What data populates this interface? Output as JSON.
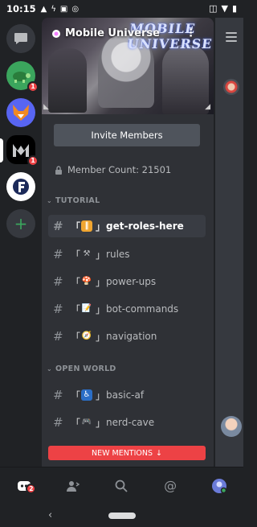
{
  "status_bar": {
    "time": "10:15",
    "icons": [
      "signal-icon",
      "bolt-icon",
      "gallery-icon",
      "sync-icon"
    ],
    "right_icons": [
      "vibrate-icon",
      "wifi-icon",
      "battery-icon"
    ]
  },
  "rail": {
    "servers": [
      {
        "name": "direct-messages",
        "icon": "chat-icon",
        "color": "#36393f"
      },
      {
        "name": "turtle-server",
        "icon": "turtle-icon",
        "color": "#3ba55d",
        "badge": "1"
      },
      {
        "name": "fox-server",
        "icon": "fox-icon",
        "color": "#5865f2"
      },
      {
        "name": "mobile-universe",
        "icon": "mu-logo-icon",
        "color": "#000000",
        "badge": "1",
        "selected": true
      },
      {
        "name": "f-server",
        "icon": "f-logo-icon",
        "color": "#ffffff"
      }
    ],
    "add_label": "+"
  },
  "server": {
    "name": "Mobile Universe",
    "wordmark": "MOBILE UNIVERSE",
    "menu_glyph": "⋮",
    "invite_label": "Invite Members",
    "member_count": "Member Count: 21501"
  },
  "categories": [
    {
      "label": "TUTORIAL",
      "channels": [
        {
          "name": "get-roles-here",
          "emoji": "‖",
          "emoji_bg": "#f0a530",
          "active": true
        },
        {
          "name": "rules",
          "emoji": "⚒",
          "emoji_bg": "transparent"
        },
        {
          "name": "power-ups",
          "emoji": "🍄",
          "emoji_bg": "transparent"
        },
        {
          "name": "bot-commands",
          "emoji": "📝",
          "emoji_bg": "transparent"
        },
        {
          "name": "navigation",
          "emoji": "🧭",
          "emoji_bg": "transparent"
        }
      ]
    },
    {
      "label": "OPEN WORLD",
      "channels": [
        {
          "name": "basic-af",
          "emoji": "♿",
          "emoji_bg": "#2b6ec6"
        },
        {
          "name": "nerd-cave",
          "emoji": "🎮",
          "emoji_bg": "transparent"
        }
      ]
    }
  ],
  "bracket_open": "「",
  "bracket_close": "」",
  "new_mentions": "NEW MENTIONS",
  "bottom_nav": {
    "home_badge": "2",
    "items": [
      "home-icon",
      "friends-icon",
      "search-icon",
      "mentions-icon",
      "profile-icon"
    ]
  },
  "colors": {
    "accent_red": "#ed4245",
    "panel": "#2f3136",
    "rail": "#202225",
    "active_channel": "#393c43"
  }
}
